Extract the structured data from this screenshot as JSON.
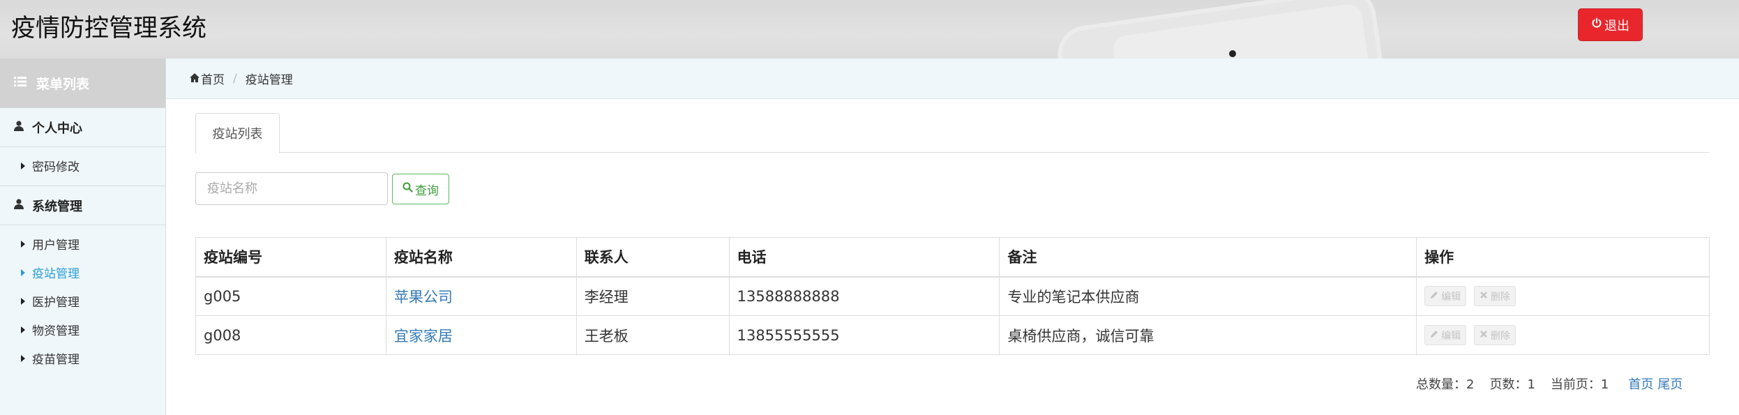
{
  "header": {
    "title": "疫情防控管理系统",
    "logout_label": "退出"
  },
  "sidebar": {
    "menu_title": "菜单列表",
    "groups": [
      {
        "title": "个人中心",
        "items": [
          {
            "label": "密码修改"
          }
        ]
      },
      {
        "title": "系统管理",
        "items": [
          {
            "label": "用户管理"
          },
          {
            "label": "疫站管理",
            "active": true
          },
          {
            "label": "医护管理"
          },
          {
            "label": "物资管理"
          },
          {
            "label": "疫苗管理"
          }
        ]
      }
    ]
  },
  "breadcrumb": {
    "home": "首页",
    "current": "疫站管理"
  },
  "tabs": [
    {
      "label": "疫站列表"
    }
  ],
  "search": {
    "placeholder": "疫站名称",
    "value": "",
    "button_label": "查询"
  },
  "table": {
    "columns": [
      "疫站编号",
      "疫站名称",
      "联系人",
      "电话",
      "备注",
      "操作"
    ],
    "rows": [
      {
        "id": "g005",
        "name": "苹果公司",
        "contact": "李经理",
        "phone": "13588888888",
        "note": "专业的笔记本供应商"
      },
      {
        "id": "g008",
        "name": "宜家家居",
        "contact": "王老板",
        "phone": "13855555555",
        "note": "桌椅供应商，诚信可靠"
      }
    ],
    "actions": {
      "edit": "编辑",
      "delete": "删除"
    }
  },
  "pagination": {
    "total": "总数量：2",
    "pages": "页数：1",
    "current": "当前页：1",
    "first": "首页",
    "last": "尾页"
  },
  "colors": {
    "accent": "#2a9fd6",
    "danger": "#e8262c",
    "success": "#5cb85c",
    "link": "#337ab7"
  }
}
